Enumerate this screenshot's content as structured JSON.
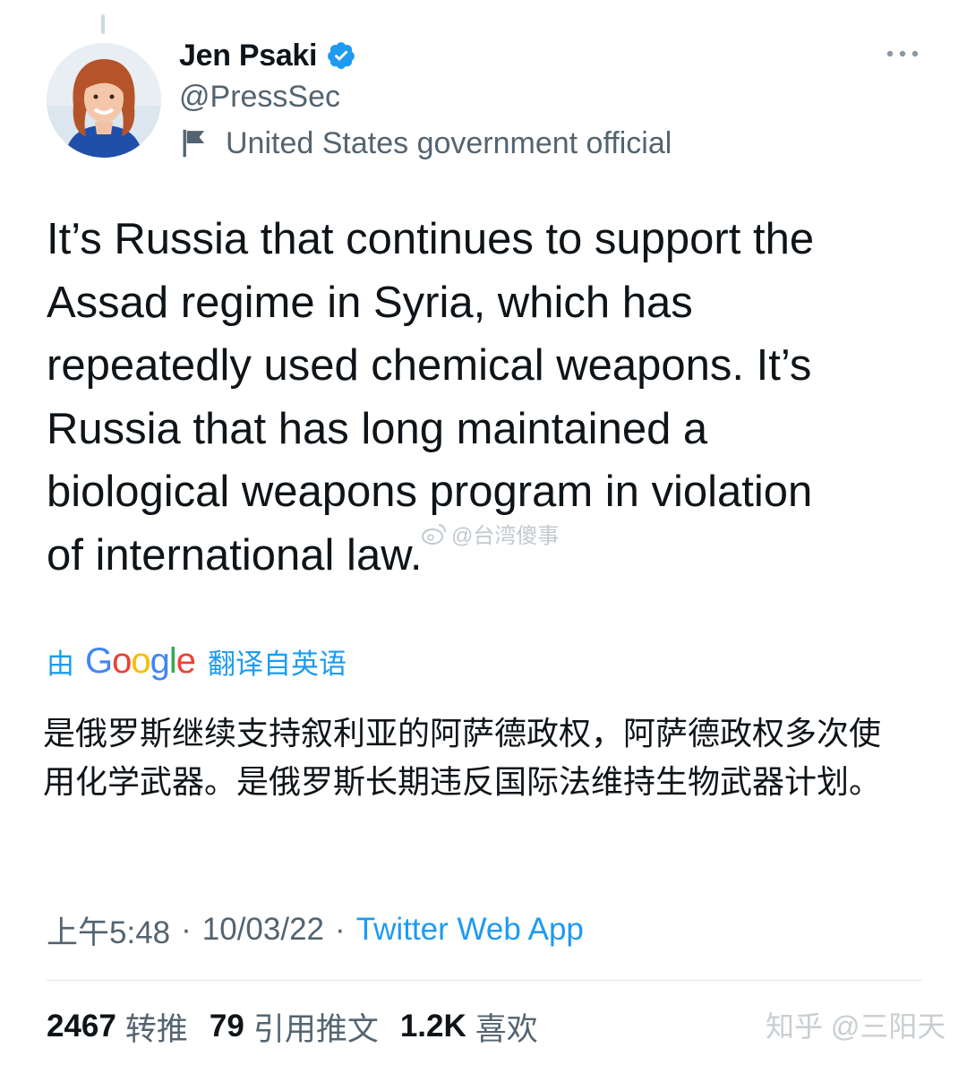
{
  "author": {
    "display_name": "Jen Psaki",
    "handle": "@PressSec",
    "label": "United States government official"
  },
  "tweet": {
    "text": "It’s Russia that continues to support the\nAssad regime in Syria, which has\nrepeatedly used chemical weapons. It’s\nRussia that has long maintained a\nbiological weapons program in violation\nof international law."
  },
  "image_watermark": "@台湾傻事",
  "translation": {
    "prefix": "由",
    "provider": "Google",
    "suffix": "翻译自英语",
    "text": "是俄罗斯继续支持叙利亚的阿萨德政权，阿萨德政权多次使用化学武器。是俄罗斯长期违反国际法维持生物武器计划。"
  },
  "meta": {
    "time": "上午5:48",
    "separator": "·",
    "date": "10/03/22",
    "source": "Twitter Web App"
  },
  "stats": {
    "retweets_count": "2467",
    "retweets_label": "转推",
    "quotes_count": "79",
    "quotes_label": "引用推文",
    "likes_count": "1.2K",
    "likes_label": "喜欢"
  },
  "zhihu_watermark": "知乎 @三阳天",
  "icons": {
    "verified": "verified-badge-icon",
    "label_flag": "flag-icon",
    "more": "more-dots-icon",
    "weibo": "weibo-icon"
  },
  "colors": {
    "accent": "#1d9bf0",
    "text": "#0f1419",
    "secondary": "#536471"
  }
}
